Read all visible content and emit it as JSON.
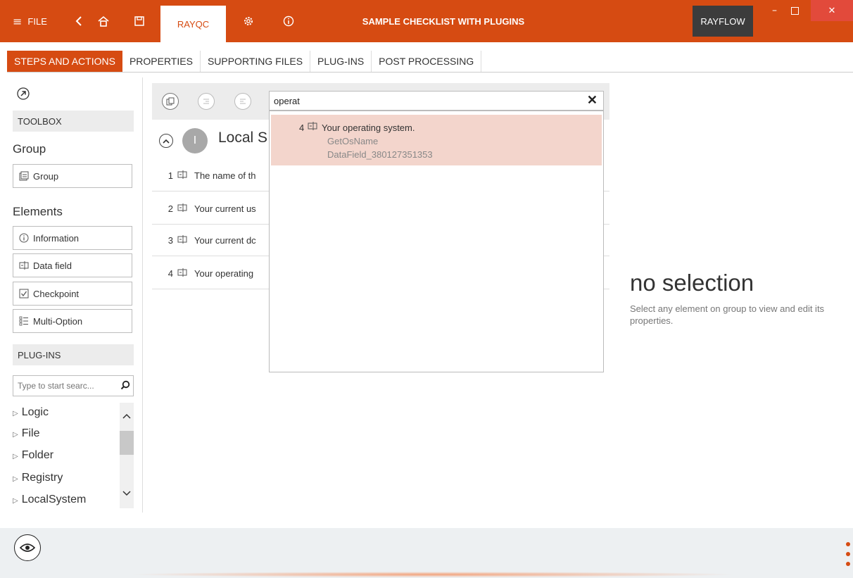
{
  "titlebar": {
    "file_label": "FILE",
    "app_tab": "RAYQC",
    "title": "SAMPLE CHECKLIST WITH PLUGINS",
    "rayflow": "RAYFLOW"
  },
  "tabs": [
    "STEPS AND ACTIONS",
    "PROPERTIES",
    "SUPPORTING FILES",
    "PLUG-INS",
    "POST PROCESSING"
  ],
  "toolbox": {
    "header": "TOOLBOX",
    "group_label": "Group",
    "group_button": "Group",
    "elements_label": "Elements",
    "elements": [
      "Information",
      "Data field",
      "Checkpoint",
      "Multi-Option"
    ]
  },
  "plugins": {
    "header": "PLUG-INS",
    "search_placeholder": "Type to start searc...",
    "tree": [
      "Logic",
      "File",
      "Folder",
      "Registry",
      "LocalSystem"
    ]
  },
  "group": {
    "badge": "I",
    "title": "Local S"
  },
  "rows": [
    {
      "num": "1",
      "text": "The name of th"
    },
    {
      "num": "2",
      "text": "Your current us"
    },
    {
      "num": "3",
      "text": "Your current dc"
    },
    {
      "num": "4",
      "text": "Your operating"
    }
  ],
  "search": {
    "query": "operat",
    "result": {
      "num": "4",
      "title": "Your operating system.",
      "plugin": "GetOsName",
      "field": "DataField_380127351353"
    }
  },
  "properties": {
    "title": "no selection",
    "description": "Select any element on group to view and edit its properties."
  },
  "colors": {
    "accent": "#d64b12",
    "highlight": "#f3d5cc"
  }
}
